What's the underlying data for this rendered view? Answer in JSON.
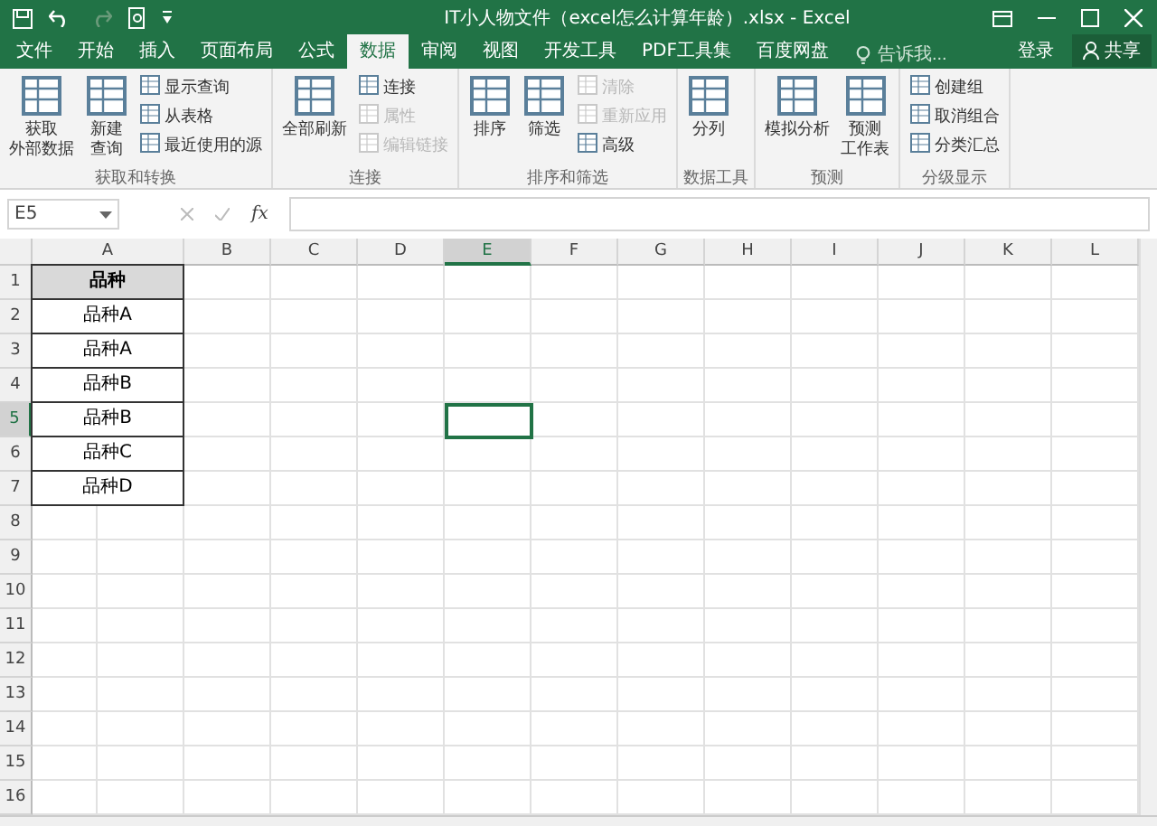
{
  "window": {
    "title": "IT小人物文件（excel怎么计算年龄）.xlsx - Excel"
  },
  "menu_tabs": [
    {
      "label": "文件",
      "selected": false
    },
    {
      "label": "开始",
      "selected": false
    },
    {
      "label": "插入",
      "selected": false
    },
    {
      "label": "页面布局",
      "selected": false
    },
    {
      "label": "公式",
      "selected": false
    },
    {
      "label": "数据",
      "selected": true
    },
    {
      "label": "审阅",
      "selected": false
    },
    {
      "label": "视图",
      "selected": false
    },
    {
      "label": "开发工具",
      "selected": false
    },
    {
      "label": "PDF工具集",
      "selected": false
    },
    {
      "label": "百度网盘",
      "selected": false
    }
  ],
  "tell_me": {
    "placeholder": "告诉我..."
  },
  "account": {
    "sign_in": "登录",
    "share": "共享"
  },
  "ribbon_groups": [
    {
      "label": "获取和转换",
      "items": [
        {
          "kind": "large",
          "lines": [
            "获取",
            "外部数据"
          ],
          "disabled": false
        },
        {
          "kind": "large",
          "lines": [
            "新建",
            "查询"
          ],
          "disabled": false
        },
        {
          "kind": "stack",
          "commands": [
            {
              "label": "显示查询",
              "disabled": false
            },
            {
              "label": "从表格",
              "disabled": false
            },
            {
              "label": "最近使用的源",
              "disabled": false
            }
          ]
        }
      ]
    },
    {
      "label": "连接",
      "items": [
        {
          "kind": "large",
          "lines": [
            "全部刷新"
          ],
          "disabled": false
        },
        {
          "kind": "stack",
          "commands": [
            {
              "label": "连接",
              "disabled": false
            },
            {
              "label": "属性",
              "disabled": true
            },
            {
              "label": "编辑链接",
              "disabled": true
            }
          ]
        }
      ]
    },
    {
      "label": "排序和筛选",
      "items": [
        {
          "kind": "large",
          "lines": [
            "排序"
          ],
          "disabled": false
        },
        {
          "kind": "large",
          "lines": [
            "筛选"
          ],
          "disabled": false
        },
        {
          "kind": "stack",
          "commands": [
            {
              "label": "清除",
              "disabled": true
            },
            {
              "label": "重新应用",
              "disabled": true
            },
            {
              "label": "高级",
              "disabled": false
            }
          ]
        }
      ]
    },
    {
      "label": "数据工具",
      "items": [
        {
          "kind": "large",
          "lines": [
            "分列"
          ],
          "disabled": false
        }
      ]
    },
    {
      "label": "预测",
      "items": [
        {
          "kind": "large",
          "lines": [
            "模拟分析"
          ],
          "disabled": false
        },
        {
          "kind": "large",
          "lines": [
            "预测",
            "工作表"
          ],
          "disabled": false
        }
      ]
    },
    {
      "label": "分级显示",
      "items": [
        {
          "kind": "stack",
          "commands": [
            {
              "label": "创建组",
              "disabled": false
            },
            {
              "label": "取消组合",
              "disabled": false
            },
            {
              "label": "分类汇总",
              "disabled": false
            }
          ]
        }
      ]
    }
  ],
  "formula_bar": {
    "name_box": "E5",
    "function_label": "fx"
  },
  "sheet": {
    "columns": [
      {
        "label": "A",
        "selected": false
      },
      {
        "label": "B",
        "selected": false
      },
      {
        "label": "C",
        "selected": false
      },
      {
        "label": "D",
        "selected": false
      },
      {
        "label": "E",
        "selected": true
      },
      {
        "label": "F",
        "selected": false
      },
      {
        "label": "G",
        "selected": false
      },
      {
        "label": "H",
        "selected": false
      },
      {
        "label": "I",
        "selected": false
      },
      {
        "label": "J",
        "selected": false
      },
      {
        "label": "K",
        "selected": false
      },
      {
        "label": "L",
        "selected": false
      }
    ],
    "rows": [
      {
        "label": "1",
        "selected": false,
        "cells": [
          {
            "text": "品种",
            "kind": "header"
          }
        ]
      },
      {
        "label": "2",
        "selected": false,
        "cells": [
          {
            "text": "品种A",
            "kind": "data"
          }
        ]
      },
      {
        "label": "3",
        "selected": false,
        "cells": [
          {
            "text": "品种A",
            "kind": "data"
          }
        ]
      },
      {
        "label": "4",
        "selected": false,
        "cells": [
          {
            "text": "品种B",
            "kind": "data"
          }
        ]
      },
      {
        "label": "5",
        "selected": true,
        "cells": [
          {
            "text": "品种B",
            "kind": "data"
          }
        ]
      },
      {
        "label": "6",
        "selected": false,
        "cells": [
          {
            "text": "品种C",
            "kind": "data"
          }
        ]
      },
      {
        "label": "7",
        "selected": false,
        "cells": [
          {
            "text": "品种D",
            "kind": "data"
          }
        ]
      },
      {
        "label": "8",
        "selected": false,
        "cells": []
      },
      {
        "label": "9",
        "selected": false,
        "cells": []
      },
      {
        "label": "10",
        "selected": false,
        "cells": []
      },
      {
        "label": "11",
        "selected": false,
        "cells": []
      },
      {
        "label": "12",
        "selected": false,
        "cells": []
      },
      {
        "label": "13",
        "selected": false,
        "cells": []
      },
      {
        "label": "14",
        "selected": false,
        "cells": []
      },
      {
        "label": "15",
        "selected": false,
        "cells": []
      },
      {
        "label": "16",
        "selected": false,
        "cells": []
      }
    ]
  }
}
